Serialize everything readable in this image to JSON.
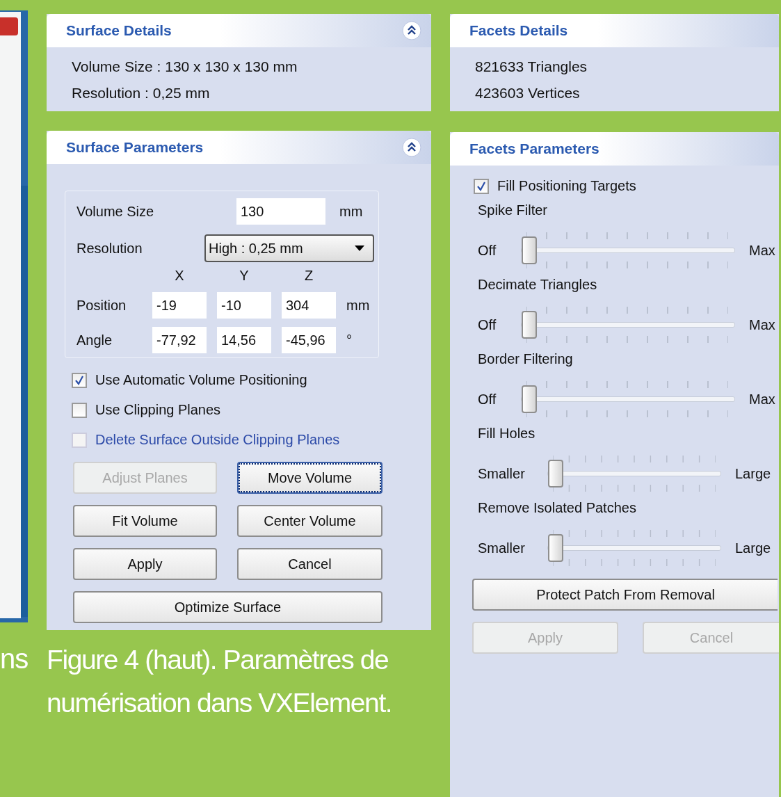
{
  "side_text": "ns",
  "surface_details": {
    "title": "Surface Details",
    "lines": [
      "Volume Size : 130 x 130 x 130 mm",
      "Resolution : 0,25 mm"
    ]
  },
  "surface_parameters": {
    "title": "Surface Parameters",
    "volume_size": {
      "label": "Volume Size",
      "value": "130",
      "unit": "mm"
    },
    "resolution": {
      "label": "Resolution",
      "value": "High : 0,25 mm"
    },
    "axes": [
      "X",
      "Y",
      "Z"
    ],
    "vectors": [
      {
        "label": "Position",
        "values": [
          "-19",
          "-10",
          "304"
        ],
        "unit": "mm"
      },
      {
        "label": "Angle",
        "values": [
          "-77,92",
          "14,56",
          "-45,96"
        ],
        "unit": "°"
      }
    ],
    "checkboxes": [
      {
        "label": "Use Automatic Volume Positioning",
        "checked": true,
        "disabled": false
      },
      {
        "label": "Use Clipping Planes",
        "checked": false,
        "disabled": false
      },
      {
        "label": "Delete Surface Outside Clipping Planes",
        "checked": false,
        "disabled": true
      }
    ],
    "buttons": [
      {
        "label": "Adjust Planes",
        "disabled": true,
        "focused": false
      },
      {
        "label": "Move Volume",
        "disabled": false,
        "focused": true
      },
      {
        "label": "Fit Volume",
        "disabled": false,
        "focused": false
      },
      {
        "label": "Center Volume",
        "disabled": false,
        "focused": false
      },
      {
        "label": "Apply",
        "disabled": false,
        "focused": false
      },
      {
        "label": "Cancel",
        "disabled": false,
        "focused": false
      }
    ],
    "optimize_button": "Optimize Surface"
  },
  "caption": "Figure 4 (haut). Paramètres de numérisation dans VXElement.",
  "facets_details": {
    "title": "Facets Details",
    "lines": [
      "821633 Triangles",
      "423603 Vertices"
    ]
  },
  "facets_parameters": {
    "title": "Facets Parameters",
    "checkbox": {
      "label": "Fill Positioning Targets",
      "checked": true
    },
    "sliders": [
      {
        "label": "Spike Filter",
        "min_label": "Off",
        "max_label": "Max",
        "level": 0
      },
      {
        "label": "Decimate Triangles",
        "min_label": "Off",
        "max_label": "Max",
        "level": 0
      },
      {
        "label": "Border Filtering",
        "min_label": "Off",
        "max_label": "Max",
        "level": 0
      },
      {
        "label": "Fill Holes",
        "min_label": "Smaller",
        "max_label": "Large",
        "level": 0
      },
      {
        "label": "Remove Isolated Patches",
        "min_label": "Smaller",
        "max_label": "Large",
        "level": 0
      }
    ],
    "protect_button": "Protect Patch From Removal",
    "buttons": [
      {
        "label": "Apply",
        "disabled": true
      },
      {
        "label": "Cancel",
        "disabled": true
      }
    ]
  }
}
